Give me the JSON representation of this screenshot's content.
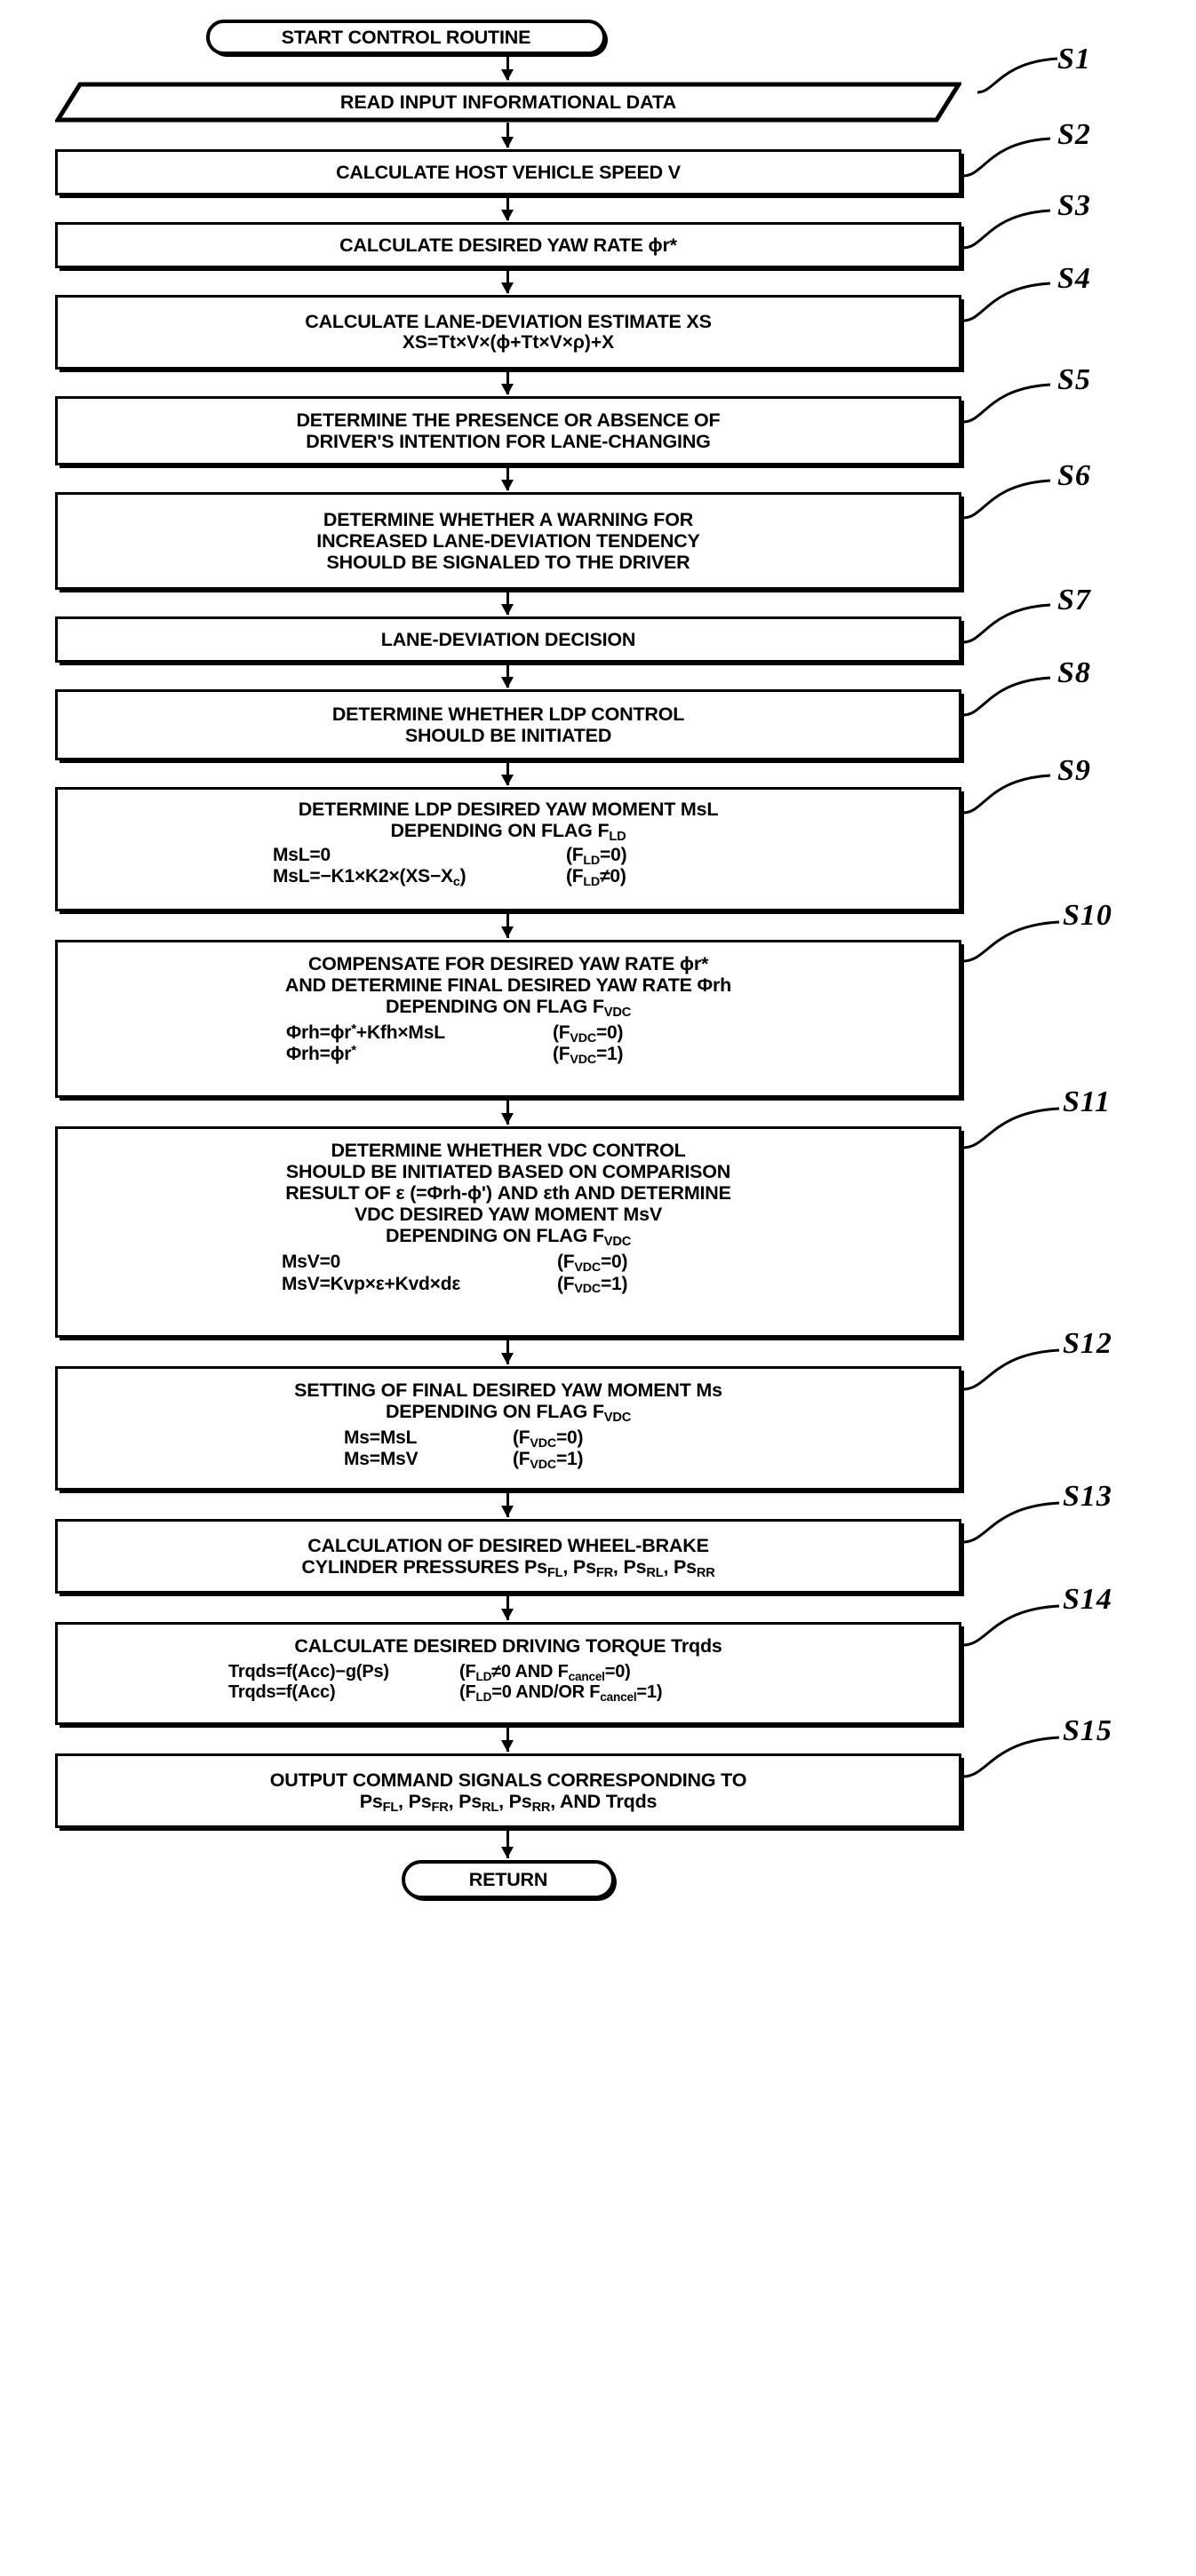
{
  "figure": {
    "type": "flowchart",
    "title": "Lane deviation prevention / VDC control routine"
  },
  "start": {
    "label": "START CONTROL ROUTINE"
  },
  "end": {
    "label": "RETURN"
  },
  "steps": [
    {
      "tag": "S1",
      "shape": "parallelogram",
      "lines": [
        "READ INPUT INFORMATIONAL DATA"
      ]
    },
    {
      "tag": "S2",
      "shape": "process",
      "lines": [
        "CALCULATE HOST VEHICLE SPEED V"
      ]
    },
    {
      "tag": "S3",
      "shape": "process",
      "lines": [
        "CALCULATE DESIRED YAW RATE ϕr*"
      ]
    },
    {
      "tag": "S4",
      "shape": "process",
      "lines": [
        "CALCULATE LANE-DEVIATION ESTIMATE XS",
        "XS=Tt×V×(ϕ+Tt×V×ρ)+X"
      ]
    },
    {
      "tag": "S5",
      "shape": "process",
      "lines": [
        "DETERMINE THE PRESENCE OR ABSENCE OF",
        "DRIVER'S INTENTION FOR LANE-CHANGING"
      ]
    },
    {
      "tag": "S6",
      "shape": "process",
      "lines": [
        "DETERMINE WHETHER A WARNING FOR",
        "INCREASED LANE-DEVIATION TENDENCY",
        "SHOULD BE SIGNALED TO THE DRIVER"
      ]
    },
    {
      "tag": "S7",
      "shape": "process",
      "lines": [
        "LANE-DEVIATION DECISION"
      ]
    },
    {
      "tag": "S8",
      "shape": "process",
      "lines": [
        "DETERMINE WHETHER LDP CONTROL",
        "SHOULD BE INITIATED"
      ]
    },
    {
      "tag": "S9",
      "shape": "process",
      "lines": [
        "DETERMINE LDP DESIRED YAW MOMENT MsL",
        "DEPENDING ON FLAG FLD"
      ],
      "equations": [
        {
          "lhs": "MsL=0",
          "rhs": "(FLD=0)"
        },
        {
          "lhs": "MsL=−K1×K2×(XS−Xc)",
          "rhs": "(FLD≠0)"
        }
      ]
    },
    {
      "tag": "S10",
      "shape": "process",
      "lines": [
        "COMPENSATE FOR DESIRED YAW RATE ϕr*",
        "AND DETERMINE FINAL DESIRED YAW RATE Φrh",
        "DEPENDING ON FLAG FVDC"
      ],
      "equations": [
        {
          "lhs": "Φrh=ϕr*+Kfh×MsL",
          "rhs": "(FVDC=0)"
        },
        {
          "lhs": "Φrh=ϕr*",
          "rhs": "(FVDC=1)"
        }
      ]
    },
    {
      "tag": "S11",
      "shape": "process",
      "lines": [
        "DETERMINE WHETHER VDC CONTROL",
        "SHOULD BE INITIATED BASED ON COMPARISON",
        "RESULT OF ε (=Φrh-ϕ') AND εth AND DETERMINE",
        "VDC DESIRED YAW MOMENT MsV",
        "DEPENDING ON FLAG FVDC"
      ],
      "equations": [
        {
          "lhs": "MsV=0",
          "rhs": "(FVDC=0)"
        },
        {
          "lhs": "MsV=Kvp×ε+Kvd×dε",
          "rhs": "(FVDC=1)"
        }
      ]
    },
    {
      "tag": "S12",
      "shape": "process",
      "lines": [
        "SETTING OF FINAL DESIRED YAW MOMENT Ms",
        "DEPENDING ON FLAG FVDC"
      ],
      "equations": [
        {
          "lhs": "Ms=MsL",
          "rhs": "(FVDC=0)"
        },
        {
          "lhs": "Ms=MsV",
          "rhs": "(FVDC=1)"
        }
      ]
    },
    {
      "tag": "S13",
      "shape": "process",
      "lines": [
        "CALCULATION OF DESIRED WHEEL-BRAKE",
        "CYLINDER PRESSURES PsFL, PsFR, PsRL, PsRR"
      ]
    },
    {
      "tag": "S14",
      "shape": "process",
      "lines": [
        "CALCULATE DESIRED DRIVING TORQUE Trqds"
      ],
      "equations": [
        {
          "lhs": "Trqds=f(Acc)−g(Ps)",
          "rhs": "(FLD≠0 AND Fcancel=0)"
        },
        {
          "lhs": "Trqds=f(Acc)",
          "rhs": "(FLD=0 AND/OR Fcancel=1)"
        }
      ]
    },
    {
      "tag": "S15",
      "shape": "process",
      "lines": [
        "OUTPUT COMMAND SIGNALS CORRESPONDING TO",
        "PsFL, PsFR, PsRL, PsRR, AND Trqds"
      ]
    }
  ],
  "colors": {
    "line": "#000000",
    "background": "#ffffff"
  }
}
